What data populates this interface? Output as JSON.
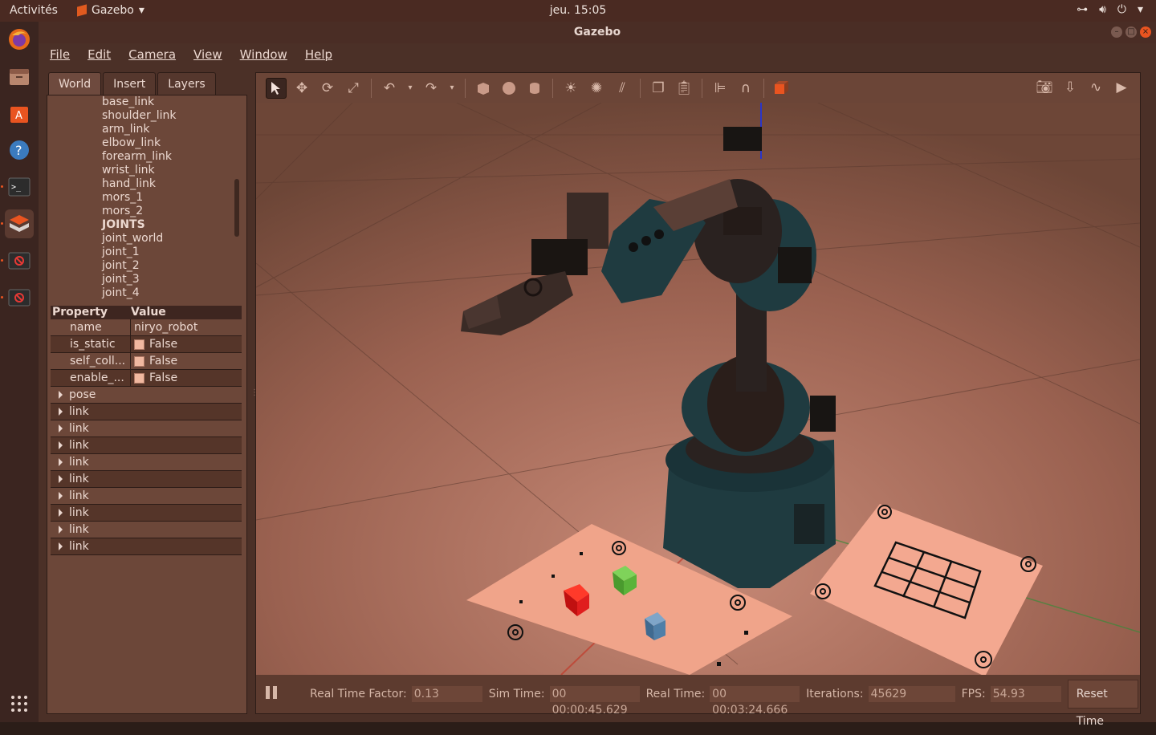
{
  "topbar": {
    "activities": "Activités",
    "app_name": "Gazebo",
    "clock": "jeu. 15:05"
  },
  "window": {
    "title": "Gazebo"
  },
  "menu": [
    "File",
    "Edit",
    "Camera",
    "View",
    "Window",
    "Help"
  ],
  "tabs": [
    "World",
    "Insert",
    "Layers"
  ],
  "tree": {
    "items": [
      "base_link",
      "shoulder_link",
      "arm_link",
      "elbow_link",
      "forearm_link",
      "wrist_link",
      "hand_link",
      "mors_1",
      "mors_2",
      "JOINTS",
      "joint_world",
      "joint_1",
      "joint_2",
      "joint_3",
      "joint_4"
    ]
  },
  "properties": {
    "header_property": "Property",
    "header_value": "Value",
    "rows": [
      {
        "key": "name",
        "value": "niryo_robot"
      },
      {
        "key": "is_static",
        "value": "False"
      },
      {
        "key": "self_coll...",
        "value": "False"
      },
      {
        "key": "enable_...",
        "value": "False"
      }
    ],
    "expandable": [
      "pose",
      "link",
      "link",
      "link",
      "link",
      "link",
      "link",
      "link",
      "link",
      "link"
    ]
  },
  "status": {
    "rtf_label": "Real Time Factor:",
    "rtf_value": "0.13",
    "sim_label": "Sim Time:",
    "sim_value": "00 00:00:45.629",
    "real_label": "Real Time:",
    "real_value": "00 00:03:24.666",
    "iter_label": "Iterations:",
    "iter_value": "45629",
    "fps_label": "FPS:",
    "fps_value": "54.93",
    "reset_label": "Reset Time"
  },
  "colors": {
    "accent": "#e95420",
    "robot_body": "#1f3b40",
    "cube_red": "#e01e1e",
    "cube_green": "#5bb33a",
    "cube_blue": "#4f7fa8",
    "ground": "#c07a66"
  }
}
